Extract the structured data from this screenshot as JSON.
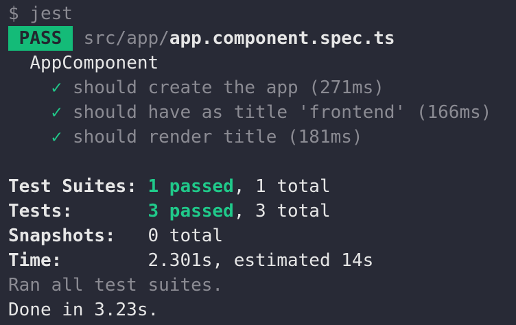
{
  "command": "$ jest",
  "result": {
    "badge": " PASS ",
    "path_dir": "src/app/",
    "path_file": "app.component.spec.ts"
  },
  "suite_name": "AppComponent",
  "tests": [
    {
      "icon": "✓",
      "label": "should create the app (271ms)"
    },
    {
      "icon": "✓",
      "label": "should have as title 'frontend' (166ms)"
    },
    {
      "icon": "✓",
      "label": "should render title (181ms)"
    }
  ],
  "summary": {
    "suites_label": "Test Suites: ",
    "suites_passed": "1 passed",
    "suites_total": ", 1 total",
    "tests_label": "Tests:       ",
    "tests_passed": "3 passed",
    "tests_total": ", 3 total",
    "snapshots_label": "Snapshots:   ",
    "snapshots_value": "0 total",
    "time_label": "Time:        ",
    "time_value": "2.301s, estimated 14s"
  },
  "ran_all": "Ran all test suites.",
  "done": "Done in 3.23s."
}
